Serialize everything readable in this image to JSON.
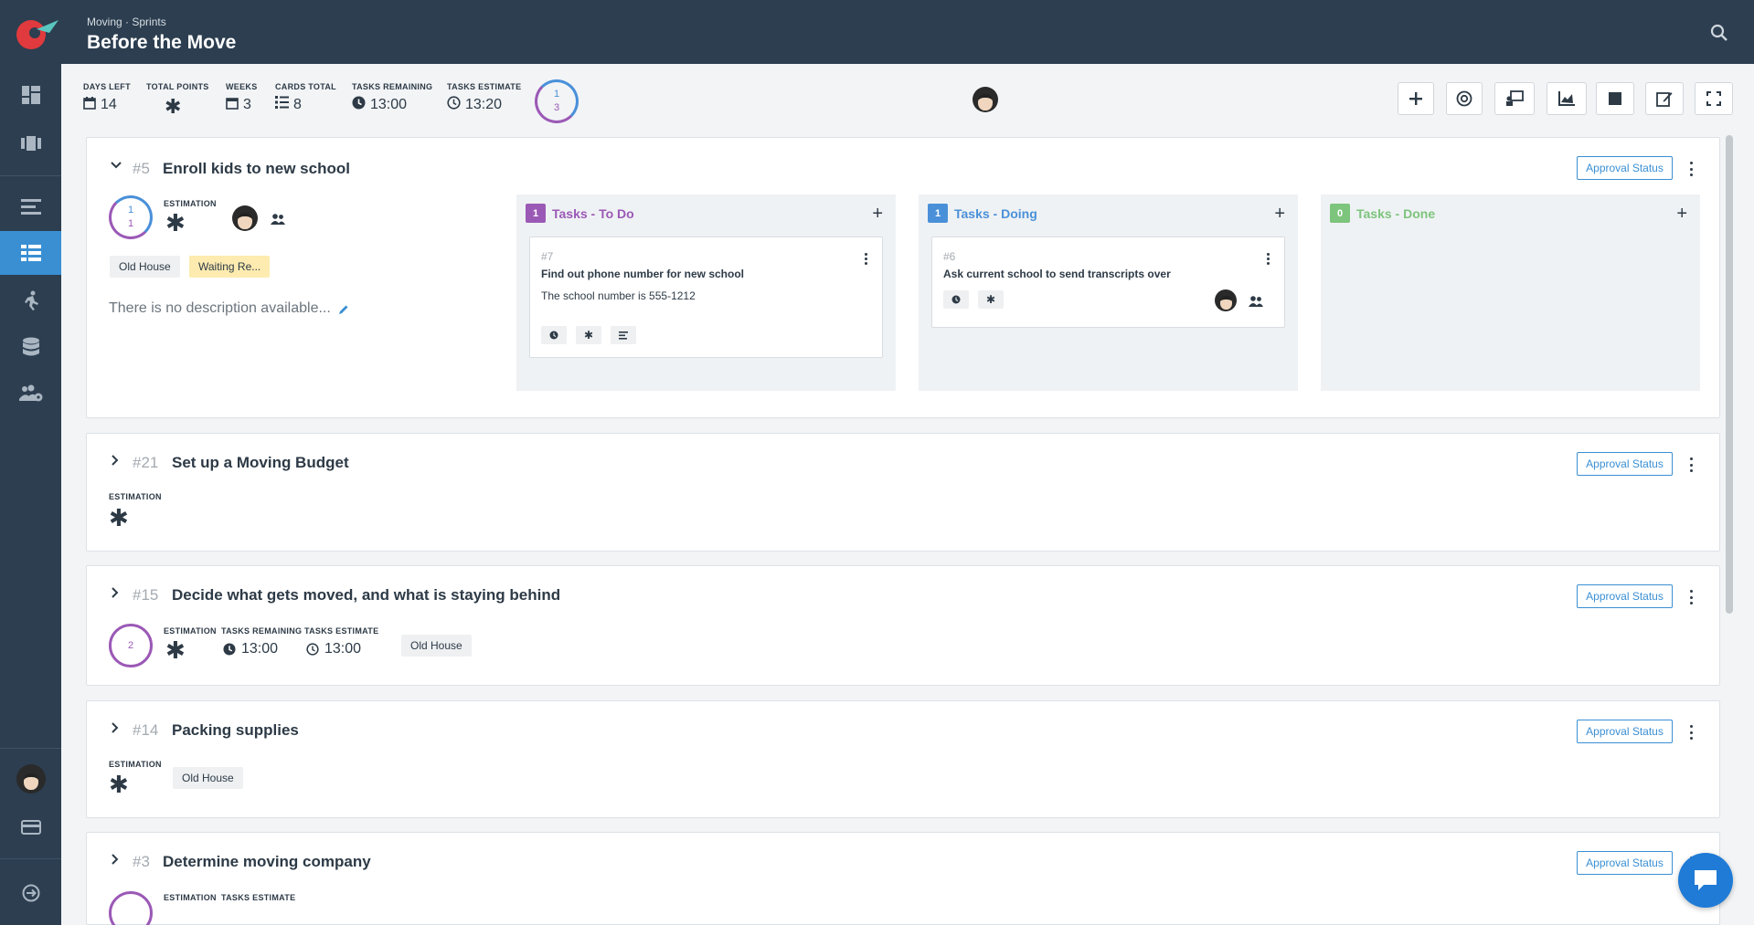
{
  "header": {
    "breadcrumb": "Moving · Sprints",
    "title": "Before the Move"
  },
  "stats": {
    "days_left": {
      "label": "DAYS LEFT",
      "value": "14"
    },
    "total_points": {
      "label": "TOTAL POINTS",
      "value": "✱"
    },
    "weeks": {
      "label": "WEEKS",
      "value": "3"
    },
    "cards_total": {
      "label": "CARDS TOTAL",
      "value": "8"
    },
    "tasks_remaining": {
      "label": "TASKS REMAINING",
      "value": "13:00"
    },
    "tasks_estimate": {
      "label": "TASKS ESTIMATE",
      "value": "13:20"
    },
    "ring": {
      "top": "1",
      "bottom": "3"
    }
  },
  "toolbar_icons": [
    "plus-icon",
    "target-icon",
    "presentation-icon",
    "chart-icon",
    "stop-icon",
    "edit-icon",
    "fullscreen-icon"
  ],
  "sidebar_icons": [
    "dashboard-icon",
    "board-icon",
    "backlog-icon",
    "sprints-icon",
    "activity-icon",
    "database-icon",
    "team-icon",
    "user-avatar",
    "billing-icon",
    "logout-icon"
  ],
  "common": {
    "approval_label": "Approval Status",
    "estimation_label": "ESTIMATION",
    "tasks_remaining_label": "TASKS REMAINING",
    "tasks_estimate_label": "TASKS ESTIMATE",
    "star": "✱"
  },
  "stories": [
    {
      "num": "#5",
      "title": "Enroll kids to new school",
      "ring": {
        "top": "1",
        "bottom": "1"
      },
      "tags": [
        "Old House",
        "Waiting Re..."
      ],
      "description": "There is no description available...",
      "columns": [
        {
          "title": "Tasks - To Do",
          "count": "1",
          "color": "#9b59b6",
          "card": {
            "num": "#7",
            "title": "Find out phone number for new school",
            "desc": "The school number is 555-1212"
          }
        },
        {
          "title": "Tasks - Doing",
          "count": "1",
          "color": "#4a90d9",
          "card": {
            "num": "#6",
            "title": "Ask current school to send transcripts over",
            "desc": ""
          }
        },
        {
          "title": "Tasks - Done",
          "count": "0",
          "color": "#7dc47d"
        }
      ]
    },
    {
      "num": "#21",
      "title": "Set up a Moving Budget"
    },
    {
      "num": "#15",
      "title": "Decide what gets moved, and what is staying behind",
      "ring": "2",
      "tasks_remaining": "13:00",
      "tasks_estimate": "13:00",
      "tags": [
        "Old House"
      ]
    },
    {
      "num": "#14",
      "title": "Packing supplies",
      "tags": [
        "Old House"
      ]
    },
    {
      "num": "#3",
      "title": "Determine moving company"
    }
  ]
}
